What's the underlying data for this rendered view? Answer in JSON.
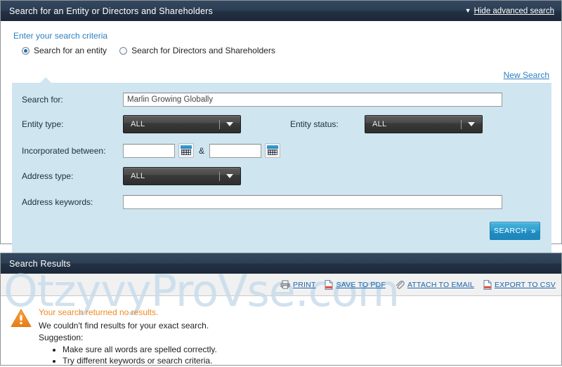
{
  "search_panel": {
    "title": "Search for an Entity or Directors and Shareholders",
    "hide_advanced": "Hide advanced search",
    "hide_advanced_caret": "▼",
    "criteria_heading": "Enter your search criteria",
    "new_search": "New Search",
    "radios": [
      {
        "label": "Search for an entity",
        "checked": true
      },
      {
        "label": "Search for Directors and Shareholders",
        "checked": false
      }
    ],
    "fields": {
      "search_for_label": "Search for:",
      "search_for_value": "Marlin Growing Globally",
      "search_for_placeholder": "",
      "entity_type_label": "Entity type:",
      "entity_type_value": "ALL",
      "entity_status_label": "Entity status:",
      "entity_status_value": "ALL",
      "incorporated_label": "Incorporated between:",
      "incorporated_from": "",
      "incorporated_to": "",
      "incorporated_separator": "&",
      "address_type_label": "Address type:",
      "address_type_value": "ALL",
      "address_keywords_label": "Address keywords:",
      "address_keywords_value": ""
    },
    "dropdown_options": [
      "ALL"
    ],
    "search_button": "SEARCH",
    "search_button_chevron": "»"
  },
  "results_panel": {
    "title": "Search Results",
    "toolbar": [
      {
        "label": "PRINT",
        "icon": "printer-icon"
      },
      {
        "label": "SAVE TO PDF",
        "icon": "pdf-document-icon"
      },
      {
        "label": "ATTACH TO EMAIL",
        "icon": "paperclip-icon"
      },
      {
        "label": "EXPORT TO CSV",
        "icon": "csv-document-icon"
      }
    ],
    "message": {
      "icon": "warning-triangle-icon",
      "title": "Your search returned no results.",
      "line1": "We couldn't find results for your exact search.",
      "line2": "Suggestion:",
      "suggestions": [
        "Make sure all words are spelled correctly.",
        "Try different keywords or search criteria."
      ]
    },
    "watermark": "OtzyvyProVse.com"
  },
  "colors": {
    "header_navy": "#2c3e53",
    "panel_blue": "#cfe5f0",
    "link_blue": "#2d7fc1",
    "accent_blue": "#1f8dc2",
    "warning_orange": "#ef8a22",
    "watermark_blue": "#c9dcec"
  }
}
